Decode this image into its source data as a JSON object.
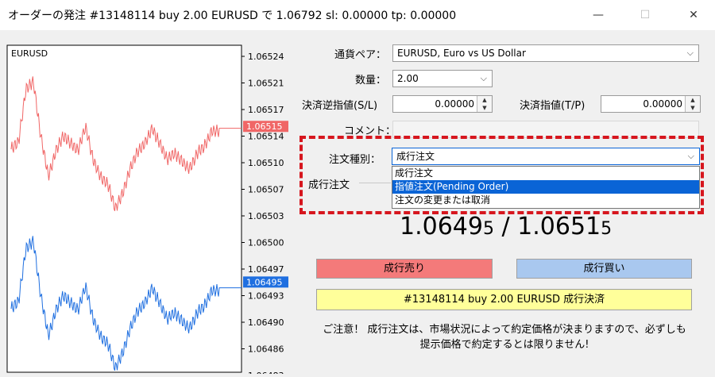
{
  "window": {
    "title": "オーダーの発注 #13148114 buy 2.00 EURUSD で 1.06792 sl: 0.00000 tp: 0.00000",
    "minimize": "—",
    "maximize": "☐",
    "close": "✕"
  },
  "chart": {
    "symbol": "EURUSD",
    "ticks": [
      "1.06524",
      "1.06521",
      "1.06517",
      "1.06514",
      "1.06510",
      "1.06507",
      "1.06503",
      "1.06500",
      "1.06497",
      "1.06493",
      "1.06490",
      "1.06486",
      "1.06483"
    ],
    "ask_label": "1.06515",
    "bid_label": "1.06495",
    "ask_color": "#f06666",
    "bid_color": "#1f6fe0"
  },
  "form": {
    "symbol_label": "通貨ペア：",
    "symbol_value": "EURUSD, Euro vs US Dollar",
    "volume_label": "数量：",
    "volume_value": "2.00",
    "sl_label": "決済逆指値(S/L)",
    "sl_value": "0.00000",
    "tp_label": "決済指値(T/P)",
    "tp_value": "0.00000",
    "comment_label": "コメント：",
    "type_label": "注文種別：",
    "type_value": "成行注文",
    "type_options": [
      "成行注文",
      "指値注文(Pending Order)",
      "注文の変更または取消"
    ],
    "section_label": "成行注文"
  },
  "prices": {
    "bid_main": "1.0649",
    "bid_small": "5",
    "sep": " / ",
    "ask_main": "1.0651",
    "ask_small": "5"
  },
  "buttons": {
    "sell": "成行売り",
    "buy": "成行買い",
    "close": "#13148114 buy 2.00 EURUSD 成行決済"
  },
  "notice": {
    "line1": "ご注意！ 成行注文は、市場状況によって約定価格が決まりますので、必ずしも",
    "line2": "提示価格で約定するとは限りません!"
  },
  "colors": {
    "highlight": "#d6161e",
    "selected": "#0a64d6"
  }
}
